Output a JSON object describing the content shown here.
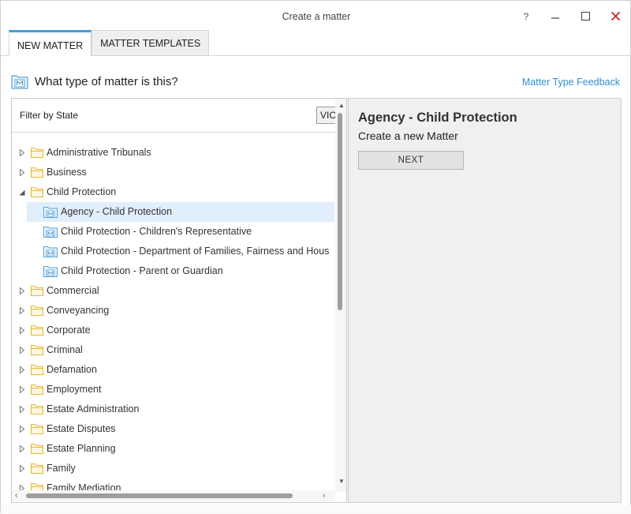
{
  "window": {
    "title": "Create a matter",
    "help_label": "?"
  },
  "tabs": [
    {
      "label": "NEW MATTER",
      "active": true
    },
    {
      "label": "MATTER TEMPLATES",
      "active": false
    }
  ],
  "header": {
    "question": "What type of matter is this?",
    "feedback_link": "Matter Type Feedback"
  },
  "filter": {
    "label": "Filter by State",
    "selected_state": "VIC"
  },
  "tree": {
    "items": [
      {
        "label": "Administrative Tribunals",
        "type": "folder",
        "expanded": false
      },
      {
        "label": "Business",
        "type": "folder",
        "expanded": false
      },
      {
        "label": "Child Protection",
        "type": "folder",
        "expanded": true
      },
      {
        "label": "Agency - Child Protection",
        "type": "matter",
        "selected": true
      },
      {
        "label": "Child Protection - Children's Representative",
        "type": "matter"
      },
      {
        "label": "Child Protection - Department of Families, Fairness and Hous",
        "type": "matter"
      },
      {
        "label": "Child Protection - Parent or Guardian",
        "type": "matter"
      },
      {
        "label": "Commercial",
        "type": "folder",
        "expanded": false
      },
      {
        "label": "Conveyancing",
        "type": "folder",
        "expanded": false
      },
      {
        "label": "Corporate",
        "type": "folder",
        "expanded": false
      },
      {
        "label": "Criminal",
        "type": "folder",
        "expanded": false
      },
      {
        "label": "Defamation",
        "type": "folder",
        "expanded": false
      },
      {
        "label": "Employment",
        "type": "folder",
        "expanded": false
      },
      {
        "label": "Estate Administration",
        "type": "folder",
        "expanded": false
      },
      {
        "label": "Estate Disputes",
        "type": "folder",
        "expanded": false
      },
      {
        "label": "Estate Planning",
        "type": "folder",
        "expanded": false
      },
      {
        "label": "Family",
        "type": "folder",
        "expanded": false
      },
      {
        "label": "Family Mediation",
        "type": "folder",
        "expanded": false
      }
    ]
  },
  "detail": {
    "title": "Agency - Child Protection",
    "subtitle": "Create a new Matter",
    "next_label": "NEXT"
  },
  "colors": {
    "accent": "#41a0d8",
    "link": "#2f8fce",
    "folder": "#e8b739",
    "selected_row": "#e1eefb",
    "close_icon": "#c62828"
  }
}
